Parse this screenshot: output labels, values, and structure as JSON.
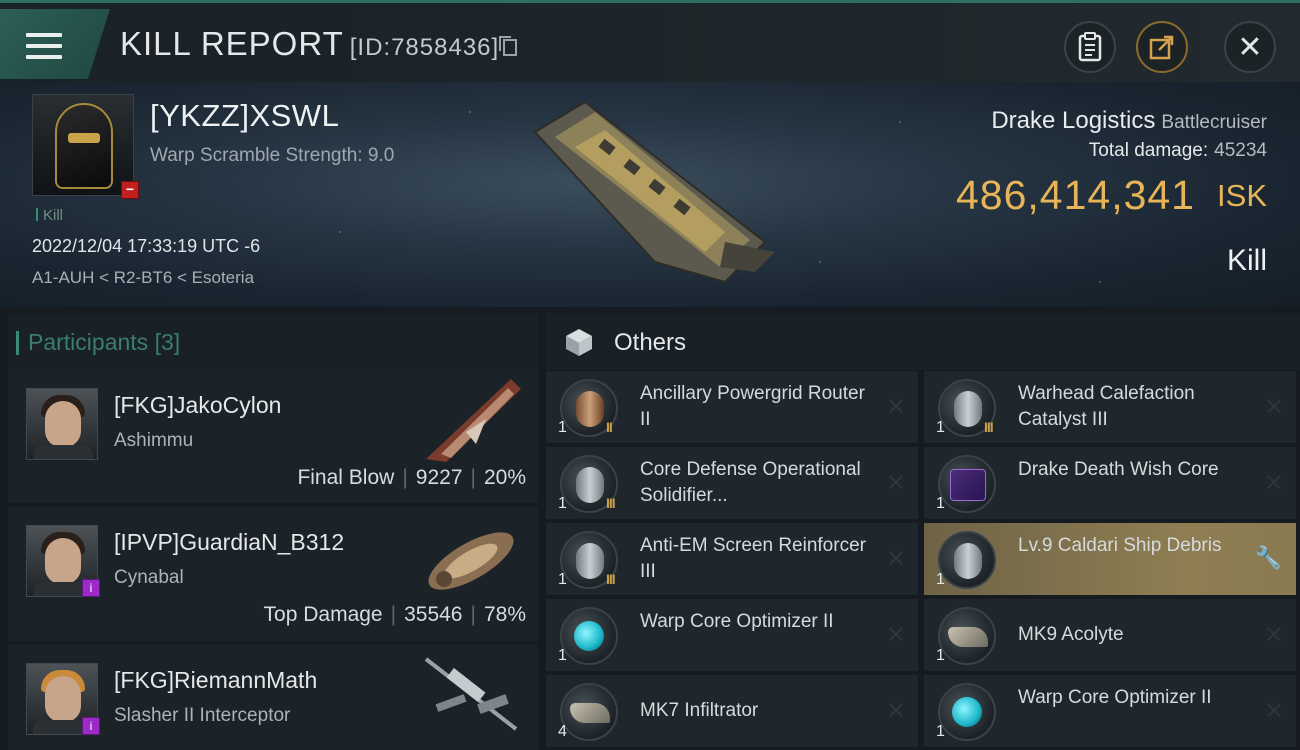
{
  "header": {
    "title": "KILL REPORT",
    "report_id": "[ID:7858436]"
  },
  "victim": {
    "name": "[YKZZ]XSWL",
    "warp_scramble": "Warp Scramble Strength: 9.0",
    "kill_tag": "Kill",
    "datetime": "2022/12/04 17:33:19 UTC -6",
    "location": "A1-AUH < R2-BT6 < Esoteria",
    "ship_name": "Drake Logistics",
    "ship_class": "Battlecruiser",
    "total_damage_label": "Total damage:",
    "total_damage": "45234",
    "isk_value": "486,414,341",
    "isk_unit": "ISK",
    "result": "Kill"
  },
  "participants": {
    "label": "Participants",
    "count": "[3]",
    "items": [
      {
        "name": "[FKG]JakoCylon",
        "ship": "Ashimmu",
        "role": "Final Blow",
        "damage": "9227",
        "percent": "20%"
      },
      {
        "name": "[IPVP]GuardiaN_B312",
        "ship": "Cynabal",
        "role": "Top Damage",
        "damage": "35546",
        "percent": "78%"
      },
      {
        "name": "[FKG]RiemannMath",
        "ship": "Slasher II Interceptor"
      }
    ]
  },
  "others": {
    "label": "Others",
    "items": [
      {
        "name": "Ancillary Powergrid Router II",
        "qty": "1",
        "tier": "II"
      },
      {
        "name": "Warhead Calefaction Catalyst III",
        "qty": "1",
        "tier": "III"
      },
      {
        "name": "Core Defense Operational Solidifier...",
        "qty": "1",
        "tier": "III"
      },
      {
        "name": "Drake Death Wish Core",
        "qty": "1",
        "tier": ""
      },
      {
        "name": "Anti-EM Screen Reinforcer III",
        "qty": "1",
        "tier": "III"
      },
      {
        "name": "Lv.9 Caldari Ship Debris",
        "qty": "1",
        "tier": ""
      },
      {
        "name": "Warp Core Optimizer II",
        "qty": "1",
        "tier": "II"
      },
      {
        "name": "MK9  Acolyte",
        "qty": "1",
        "tier": ""
      },
      {
        "name": "MK7  Infiltrator",
        "qty": "4",
        "tier": ""
      },
      {
        "name": "Warp Core Optimizer II",
        "qty": "1",
        "tier": "II"
      }
    ]
  },
  "icons": {
    "close": "✕",
    "remove": "✕",
    "wrench": "🔧"
  },
  "colors": {
    "accent_teal": "#3a8a79",
    "isk_gold": "#e8b458",
    "highlight_row": "#8f7e52"
  }
}
